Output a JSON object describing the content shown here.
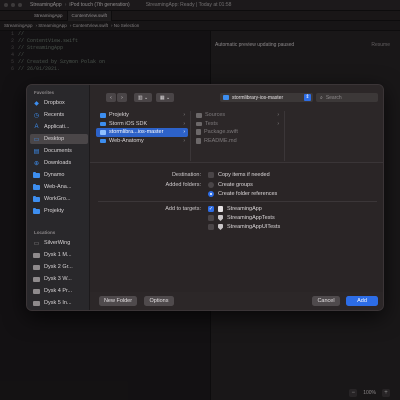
{
  "xcode": {
    "title": "StreamingApp",
    "device": "iPod touch (7th generation)",
    "status": "StreamingApp: Ready | Today at 01:58",
    "tabs": [
      "StreamingApp",
      "ContentView.swift"
    ],
    "breadcrumb": [
      "StreamingApp",
      "StreamingApp",
      "ContentView.swift",
      "No Selection"
    ],
    "code_lines": [
      {
        "n": "1",
        "text": "//"
      },
      {
        "n": "2",
        "text": "//  ContentView.swift"
      },
      {
        "n": "3",
        "text": "//  StreamingApp"
      },
      {
        "n": "4",
        "text": "//"
      },
      {
        "n": "5",
        "text": "//  Created by Szymon Polak on"
      },
      {
        "n": "6",
        "text": "//  26/01/2021."
      }
    ],
    "preview_status": "Automatic preview updating paused",
    "preview_resume": "Resume",
    "zoom": "100%"
  },
  "sidebar": {
    "favorites_label": "Favorites",
    "favorites": [
      {
        "label": "Dropbox",
        "icon": "dropbox-icon",
        "selected": false
      },
      {
        "label": "Recents",
        "icon": "clock-icon",
        "selected": false
      },
      {
        "label": "Applicati...",
        "icon": "applications-icon",
        "selected": false
      },
      {
        "label": "Desktop",
        "icon": "desktop-icon",
        "selected": true
      },
      {
        "label": "Documents",
        "icon": "document-icon",
        "selected": false
      },
      {
        "label": "Downloads",
        "icon": "download-icon",
        "selected": false
      },
      {
        "label": "Dynamo",
        "icon": "folder-icon",
        "selected": false
      },
      {
        "label": "Web-Ana...",
        "icon": "folder-icon",
        "selected": false
      },
      {
        "label": "WorkGro...",
        "icon": "folder-icon",
        "selected": false
      },
      {
        "label": "Projekty",
        "icon": "folder-icon",
        "selected": false
      }
    ],
    "locations_label": "Locations",
    "locations": [
      {
        "label": "SilverWing",
        "icon": "computer-icon"
      },
      {
        "label": "Dysk 1 M...",
        "icon": "disk-icon"
      },
      {
        "label": "Dysk 2 Gr...",
        "icon": "disk-icon"
      },
      {
        "label": "Dysk 3 W...",
        "icon": "disk-icon"
      },
      {
        "label": "Dysk 4 Pr...",
        "icon": "disk-icon"
      },
      {
        "label": "Dysk 5 In...",
        "icon": "disk-icon"
      }
    ]
  },
  "toolbar": {
    "back": "‹",
    "forward": "›",
    "path": "stormlibrary-ios-master",
    "search_placeholder": "Search"
  },
  "browser": {
    "column1": [
      {
        "label": "Projekty",
        "type": "folder",
        "selected": false
      },
      {
        "label": "Storm iOS SDK",
        "type": "folder",
        "selected": false
      },
      {
        "label": "stormlibra...ios-master",
        "type": "folder",
        "selected": true
      },
      {
        "label": "Web-Anatomy",
        "type": "folder",
        "selected": false
      }
    ],
    "column2": [
      {
        "label": "Sources",
        "type": "folder"
      },
      {
        "label": "Tests",
        "type": "folder"
      },
      {
        "label": "Package.swift",
        "type": "file"
      },
      {
        "label": "README.md",
        "type": "file"
      }
    ]
  },
  "options": {
    "destination_label": "Destination:",
    "copy_label": "Copy items if needed",
    "copy_checked": false,
    "added_folders_label": "Added folders:",
    "create_groups": "Create groups",
    "create_references": "Create folder references",
    "add_to_targets_label": "Add to targets:",
    "targets": [
      {
        "label": "StreamingApp",
        "checked": true
      },
      {
        "label": "StreamingAppTests",
        "checked": false
      },
      {
        "label": "StreamingAppUITests",
        "checked": false
      }
    ]
  },
  "footer": {
    "new_folder": "New Folder",
    "options": "Options",
    "cancel": "Cancel",
    "add": "Add"
  },
  "colors": {
    "accent": "#2d6de6",
    "folder": "#3d8ef0"
  }
}
